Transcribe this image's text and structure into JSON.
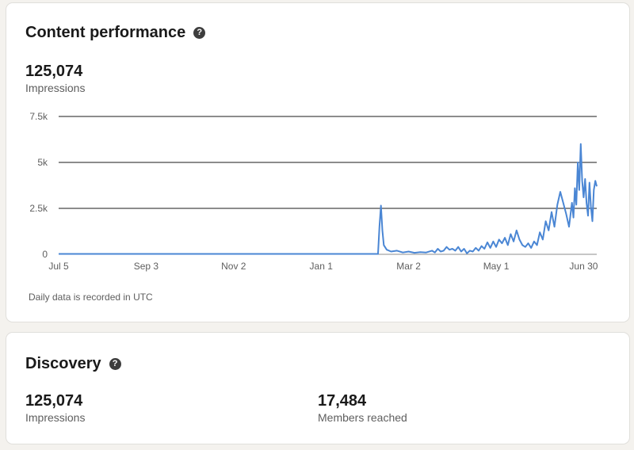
{
  "content_performance": {
    "title": "Content performance",
    "help_icon": "question-circle-icon",
    "impressions_value": "125,074",
    "impressions_label": "Impressions",
    "footnote": "Daily data is recorded in UTC"
  },
  "discovery": {
    "title": "Discovery",
    "help_icon": "question-circle-icon",
    "impressions_value": "125,074",
    "impressions_label": "Impressions",
    "members_value": "17,484",
    "members_label": "Members reached"
  },
  "colors": {
    "line": "#4a86d4",
    "grid": "#1a1a1a",
    "text_muted": "#5e5e5e"
  },
  "chart_data": {
    "type": "line",
    "x_range": [
      "Jul 5",
      "Jun 30"
    ],
    "x_tick_labels": [
      "Jul 5",
      "Sep 3",
      "Nov 2",
      "Jan 1",
      "Mar 2",
      "May 1",
      "Jun 30"
    ],
    "x_tick_day_index": [
      0,
      60,
      120,
      180,
      240,
      300,
      360
    ],
    "y_tick_labels": [
      "0",
      "2.5k",
      "5k",
      "7.5k"
    ],
    "y_tick_values": [
      0,
      2500,
      5000,
      7500
    ],
    "ylim": [
      0,
      7500
    ],
    "grid": "horizontal",
    "series": [
      {
        "points": [
          [
            0,
            20
          ],
          [
            60,
            20
          ],
          [
            120,
            20
          ],
          [
            180,
            20
          ],
          [
            219,
            20
          ],
          [
            220,
            1500
          ],
          [
            221,
            2650
          ],
          [
            222,
            1300
          ],
          [
            223,
            500
          ],
          [
            225,
            250
          ],
          [
            228,
            150
          ],
          [
            232,
            200
          ],
          [
            236,
            100
          ],
          [
            240,
            150
          ],
          [
            244,
            80
          ],
          [
            248,
            120
          ],
          [
            252,
            100
          ],
          [
            256,
            200
          ],
          [
            258,
            100
          ],
          [
            260,
            300
          ],
          [
            262,
            150
          ],
          [
            264,
            200
          ],
          [
            266,
            400
          ],
          [
            268,
            250
          ],
          [
            270,
            300
          ],
          [
            272,
            200
          ],
          [
            274,
            400
          ],
          [
            276,
            150
          ],
          [
            278,
            300
          ],
          [
            280,
            50
          ],
          [
            282,
            200
          ],
          [
            284,
            150
          ],
          [
            286,
            350
          ],
          [
            288,
            200
          ],
          [
            290,
            450
          ],
          [
            292,
            300
          ],
          [
            294,
            650
          ],
          [
            296,
            350
          ],
          [
            298,
            700
          ],
          [
            300,
            400
          ],
          [
            302,
            800
          ],
          [
            304,
            600
          ],
          [
            306,
            900
          ],
          [
            308,
            500
          ],
          [
            310,
            1100
          ],
          [
            312,
            700
          ],
          [
            314,
            1300
          ],
          [
            316,
            800
          ],
          [
            318,
            500
          ],
          [
            320,
            400
          ],
          [
            322,
            600
          ],
          [
            324,
            350
          ],
          [
            326,
            700
          ],
          [
            328,
            500
          ],
          [
            330,
            1200
          ],
          [
            332,
            800
          ],
          [
            334,
            1800
          ],
          [
            336,
            1300
          ],
          [
            338,
            2300
          ],
          [
            340,
            1500
          ],
          [
            342,
            2700
          ],
          [
            344,
            3400
          ],
          [
            346,
            2800
          ],
          [
            348,
            2200
          ],
          [
            350,
            1500
          ],
          [
            352,
            2800
          ],
          [
            353,
            2000
          ],
          [
            354,
            3600
          ],
          [
            355,
            2700
          ],
          [
            356,
            5000
          ],
          [
            357,
            3500
          ],
          [
            358,
            6000
          ],
          [
            359,
            4000
          ],
          [
            360,
            3100
          ],
          [
            361,
            4100
          ],
          [
            362,
            2800
          ],
          [
            363,
            2100
          ],
          [
            364,
            3900
          ],
          [
            365,
            2600
          ],
          [
            366,
            1800
          ],
          [
            367,
            3500
          ],
          [
            368,
            4000
          ],
          [
            369,
            3700
          ]
        ]
      }
    ]
  }
}
